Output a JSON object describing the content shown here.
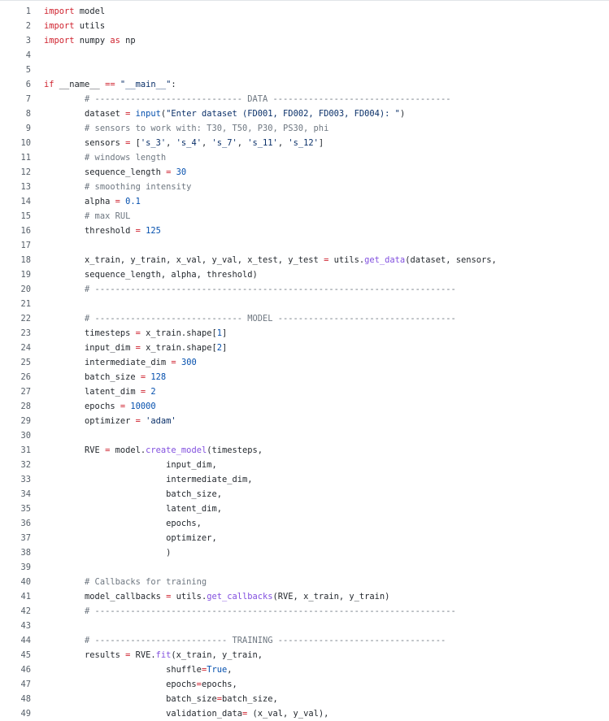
{
  "code_viewer": {
    "lines": [
      {
        "n": "1",
        "segs": [
          [
            "kw",
            "import"
          ],
          [
            "t",
            " model"
          ]
        ]
      },
      {
        "n": "2",
        "segs": [
          [
            "kw",
            "import"
          ],
          [
            "t",
            " utils"
          ]
        ]
      },
      {
        "n": "3",
        "segs": [
          [
            "kw",
            "import"
          ],
          [
            "t",
            " numpy "
          ],
          [
            "kw",
            "as"
          ],
          [
            "t",
            " np"
          ]
        ]
      },
      {
        "n": "4",
        "segs": []
      },
      {
        "n": "5",
        "segs": []
      },
      {
        "n": "6",
        "segs": [
          [
            "kw",
            "if"
          ],
          [
            "t",
            " __name__ "
          ],
          [
            "op",
            "=="
          ],
          [
            "t",
            " "
          ],
          [
            "str",
            "\"__main__\""
          ],
          [
            "t",
            ":"
          ]
        ]
      },
      {
        "n": "7",
        "segs": [
          [
            "t",
            "        "
          ],
          [
            "cm",
            "# ----------------------------- DATA -----------------------------------"
          ]
        ]
      },
      {
        "n": "8",
        "segs": [
          [
            "t",
            "        dataset "
          ],
          [
            "op",
            "="
          ],
          [
            "t",
            " "
          ],
          [
            "bi",
            "input"
          ],
          [
            "t",
            "("
          ],
          [
            "str",
            "\"Enter dataset (FD001, FD002, FD003, FD004): \""
          ],
          [
            "t",
            ")"
          ]
        ]
      },
      {
        "n": "9",
        "segs": [
          [
            "t",
            "        "
          ],
          [
            "cm",
            "# sensors to work with: T30, T50, P30, PS30, phi"
          ]
        ]
      },
      {
        "n": "10",
        "segs": [
          [
            "t",
            "        sensors "
          ],
          [
            "op",
            "="
          ],
          [
            "t",
            " ["
          ],
          [
            "str",
            "'s_3'"
          ],
          [
            "t",
            ", "
          ],
          [
            "str",
            "'s_4'"
          ],
          [
            "t",
            ", "
          ],
          [
            "str",
            "'s_7'"
          ],
          [
            "t",
            ", "
          ],
          [
            "str",
            "'s_11'"
          ],
          [
            "t",
            ", "
          ],
          [
            "str",
            "'s_12'"
          ],
          [
            "t",
            "]"
          ]
        ]
      },
      {
        "n": "11",
        "segs": [
          [
            "t",
            "        "
          ],
          [
            "cm",
            "# windows length"
          ]
        ]
      },
      {
        "n": "12",
        "segs": [
          [
            "t",
            "        sequence_length "
          ],
          [
            "op",
            "="
          ],
          [
            "t",
            " "
          ],
          [
            "num",
            "30"
          ]
        ]
      },
      {
        "n": "13",
        "segs": [
          [
            "t",
            "        "
          ],
          [
            "cm",
            "# smoothing intensity"
          ]
        ]
      },
      {
        "n": "14",
        "segs": [
          [
            "t",
            "        alpha "
          ],
          [
            "op",
            "="
          ],
          [
            "t",
            " "
          ],
          [
            "num",
            "0.1"
          ]
        ]
      },
      {
        "n": "15",
        "segs": [
          [
            "t",
            "        "
          ],
          [
            "cm",
            "# max RUL"
          ]
        ]
      },
      {
        "n": "16",
        "segs": [
          [
            "t",
            "        threshold "
          ],
          [
            "op",
            "="
          ],
          [
            "t",
            " "
          ],
          [
            "num",
            "125"
          ]
        ]
      },
      {
        "n": "17",
        "segs": []
      },
      {
        "n": "18",
        "segs": [
          [
            "t",
            "        x_train, y_train, x_val, y_val, x_test, y_test "
          ],
          [
            "op",
            "="
          ],
          [
            "t",
            " utils."
          ],
          [
            "fn",
            "get_data"
          ],
          [
            "t",
            "(dataset, sensors,"
          ]
        ]
      },
      {
        "n": "19",
        "segs": [
          [
            "t",
            "        sequence_length, alpha, threshold)"
          ]
        ]
      },
      {
        "n": "20",
        "segs": [
          [
            "t",
            "        "
          ],
          [
            "cm",
            "# -----------------------------------------------------------------------"
          ]
        ]
      },
      {
        "n": "21",
        "segs": []
      },
      {
        "n": "22",
        "segs": [
          [
            "t",
            "        "
          ],
          [
            "cm",
            "# ----------------------------- MODEL -----------------------------------"
          ]
        ]
      },
      {
        "n": "23",
        "segs": [
          [
            "t",
            "        timesteps "
          ],
          [
            "op",
            "="
          ],
          [
            "t",
            " x_train.shape["
          ],
          [
            "num",
            "1"
          ],
          [
            "t",
            "]"
          ]
        ]
      },
      {
        "n": "24",
        "segs": [
          [
            "t",
            "        input_dim "
          ],
          [
            "op",
            "="
          ],
          [
            "t",
            " x_train.shape["
          ],
          [
            "num",
            "2"
          ],
          [
            "t",
            "]"
          ]
        ]
      },
      {
        "n": "25",
        "segs": [
          [
            "t",
            "        intermediate_dim "
          ],
          [
            "op",
            "="
          ],
          [
            "t",
            " "
          ],
          [
            "num",
            "300"
          ]
        ]
      },
      {
        "n": "26",
        "segs": [
          [
            "t",
            "        batch_size "
          ],
          [
            "op",
            "="
          ],
          [
            "t",
            " "
          ],
          [
            "num",
            "128"
          ]
        ]
      },
      {
        "n": "27",
        "segs": [
          [
            "t",
            "        latent_dim "
          ],
          [
            "op",
            "="
          ],
          [
            "t",
            " "
          ],
          [
            "num",
            "2"
          ]
        ]
      },
      {
        "n": "28",
        "segs": [
          [
            "t",
            "        epochs "
          ],
          [
            "op",
            "="
          ],
          [
            "t",
            " "
          ],
          [
            "num",
            "10000"
          ]
        ]
      },
      {
        "n": "29",
        "segs": [
          [
            "t",
            "        optimizer "
          ],
          [
            "op",
            "="
          ],
          [
            "t",
            " "
          ],
          [
            "str",
            "'adam'"
          ]
        ]
      },
      {
        "n": "30",
        "segs": []
      },
      {
        "n": "31",
        "segs": [
          [
            "t",
            "        RVE "
          ],
          [
            "op",
            "="
          ],
          [
            "t",
            " model."
          ],
          [
            "fn",
            "create_model"
          ],
          [
            "t",
            "(timesteps,"
          ]
        ]
      },
      {
        "n": "32",
        "segs": [
          [
            "t",
            "                        input_dim,"
          ]
        ]
      },
      {
        "n": "33",
        "segs": [
          [
            "t",
            "                        intermediate_dim,"
          ]
        ]
      },
      {
        "n": "34",
        "segs": [
          [
            "t",
            "                        batch_size,"
          ]
        ]
      },
      {
        "n": "35",
        "segs": [
          [
            "t",
            "                        latent_dim,"
          ]
        ]
      },
      {
        "n": "36",
        "segs": [
          [
            "t",
            "                        epochs,"
          ]
        ]
      },
      {
        "n": "37",
        "segs": [
          [
            "t",
            "                        optimizer,"
          ]
        ]
      },
      {
        "n": "38",
        "segs": [
          [
            "t",
            "                        )"
          ]
        ]
      },
      {
        "n": "39",
        "segs": []
      },
      {
        "n": "40",
        "segs": [
          [
            "t",
            "        "
          ],
          [
            "cm",
            "# Callbacks for training"
          ]
        ]
      },
      {
        "n": "41",
        "segs": [
          [
            "t",
            "        model_callbacks "
          ],
          [
            "op",
            "="
          ],
          [
            "t",
            " utils."
          ],
          [
            "fn",
            "get_callbacks"
          ],
          [
            "t",
            "(RVE, x_train, y_train)"
          ]
        ]
      },
      {
        "n": "42",
        "segs": [
          [
            "t",
            "        "
          ],
          [
            "cm",
            "# -----------------------------------------------------------------------"
          ]
        ]
      },
      {
        "n": "43",
        "segs": []
      },
      {
        "n": "44",
        "segs": [
          [
            "t",
            "        "
          ],
          [
            "cm",
            "# -------------------------- TRAINING ---------------------------------"
          ]
        ]
      },
      {
        "n": "45",
        "segs": [
          [
            "t",
            "        results "
          ],
          [
            "op",
            "="
          ],
          [
            "t",
            " RVE."
          ],
          [
            "fn",
            "fit"
          ],
          [
            "t",
            "(x_train, y_train,"
          ]
        ]
      },
      {
        "n": "46",
        "segs": [
          [
            "t",
            "                        shuffle"
          ],
          [
            "op",
            "="
          ],
          [
            "bi",
            "True"
          ],
          [
            "t",
            ","
          ]
        ]
      },
      {
        "n": "47",
        "segs": [
          [
            "t",
            "                        epochs"
          ],
          [
            "op",
            "="
          ],
          [
            "t",
            "epochs,"
          ]
        ]
      },
      {
        "n": "48",
        "segs": [
          [
            "t",
            "                        batch_size"
          ],
          [
            "op",
            "="
          ],
          [
            "t",
            "batch_size,"
          ]
        ]
      },
      {
        "n": "49",
        "segs": [
          [
            "t",
            "                        validation_data"
          ],
          [
            "op",
            "="
          ],
          [
            "t",
            " (x_val, y_val),"
          ]
        ]
      }
    ]
  }
}
